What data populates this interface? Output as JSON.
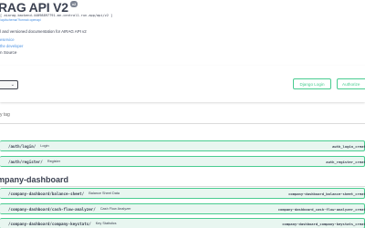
{
  "header": {
    "title": "RAG API V2",
    "version_badge": "v2",
    "base_url": "[ aiarag-backend-44098897791.me-central1.run.app/api/v2 ]",
    "schema_link": "/api/schema/?format=openapi"
  },
  "info": {
    "description": "l and versioned documentation for AIRAG API v2",
    "links": [
      "eservice",
      "the developer"
    ],
    "plain": "n Source"
  },
  "scheme_selector": {
    "chevron_icon": "chevron-down-icon"
  },
  "actions": {
    "django_login": "Django Login",
    "authorize": "Authorize"
  },
  "filter": {
    "placeholder": "y tag"
  },
  "operations_auth": [
    {
      "path": "/auth/login/",
      "summary": "Login",
      "operation_id": "auth_login_create"
    },
    {
      "path": "/auth/register/",
      "summary": "Register",
      "operation_id": "auth_register_create"
    }
  ],
  "tag_company": {
    "heading": "mpany-dashboard"
  },
  "operations_company": [
    {
      "path": "/company-dashboard/balance-sheet/",
      "summary": "Balance Sheet Data",
      "operation_id": "company-dashboard_balance-sheet_create"
    },
    {
      "path": "/company-dashboard/cash-flow-analyzer/",
      "summary": "Cash Flow Analyzer",
      "operation_id": "company-dashboard_cash-flow-analyzer_create"
    },
    {
      "path": "/company-dashboard/company-keystats/",
      "summary": "Key Statistics",
      "operation_id": "company-dashboard_company-keystats_create"
    }
  ],
  "colors": {
    "post_green": "#49cc90",
    "post_bg": "#e8f6f0",
    "link_blue": "#4990e2",
    "text": "#3b4151"
  }
}
